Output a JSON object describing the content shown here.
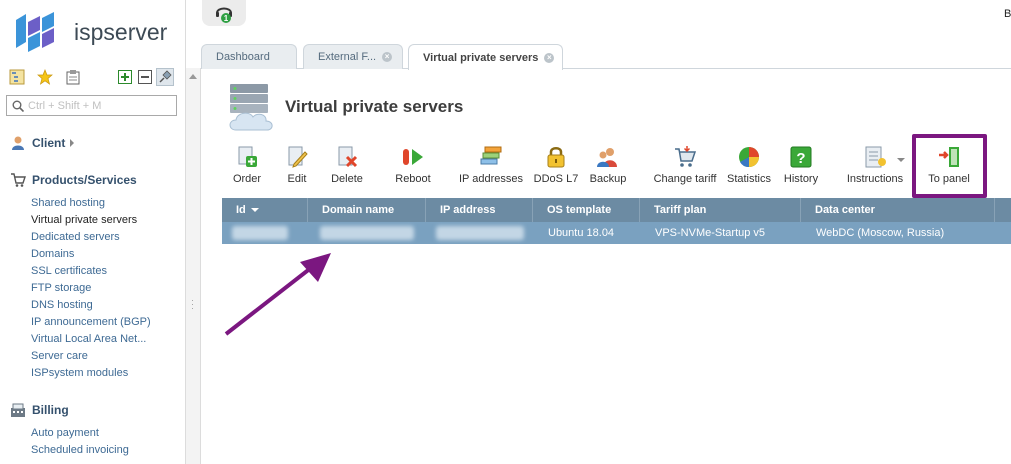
{
  "app": {
    "logo_text": "ispserver",
    "user_initial": "B",
    "notification_count": "1"
  },
  "sidebar": {
    "search_placeholder": "Ctrl + Shift + M",
    "groups": [
      {
        "label": "Client",
        "items": []
      },
      {
        "label": "Products/Services",
        "items": [
          "Shared hosting",
          "Virtual private servers",
          "Dedicated servers",
          "Domains",
          "SSL certificates",
          "FTP storage",
          "DNS hosting",
          "IP announcement (BGP)",
          "Virtual Local Area Net...",
          "Server care",
          "ISPsystem modules"
        ]
      },
      {
        "label": "Billing",
        "items": [
          "Auto payment",
          "Scheduled invoicing"
        ]
      }
    ],
    "active_item": "Virtual private servers"
  },
  "tabs": [
    {
      "label": "Dashboard"
    },
    {
      "label": "External F..."
    },
    {
      "label": "Virtual private servers"
    }
  ],
  "page": {
    "title": "Virtual private servers"
  },
  "toolbar": {
    "buttons": [
      {
        "label": "Order",
        "icon": "order-plus-icon"
      },
      {
        "label": "Edit",
        "icon": "edit-icon"
      },
      {
        "label": "Delete",
        "icon": "delete-icon"
      },
      {
        "label": "Reboot",
        "icon": "reboot-icon"
      },
      {
        "label": "IP addresses",
        "icon": "ip-addresses-icon"
      },
      {
        "label": "DDoS L7",
        "icon": "lock-icon"
      },
      {
        "label": "Backup",
        "icon": "backup-icon"
      },
      {
        "label": "Change tariff",
        "icon": "cart-icon"
      },
      {
        "label": "Statistics",
        "icon": "pie-chart-icon"
      },
      {
        "label": "History",
        "icon": "history-icon"
      },
      {
        "label": "Instructions",
        "icon": "instructions-icon"
      },
      {
        "label": "To panel",
        "icon": "to-panel-icon"
      }
    ]
  },
  "grid": {
    "columns": [
      "Id",
      "Domain name",
      "IP address",
      "OS template",
      "Tariff plan",
      "Data center"
    ],
    "rows": [
      {
        "os_template": "Ubuntu 18.04",
        "tariff_plan": "VPS-NVMe-Startup v5",
        "data_center": "WebDC (Moscow, Russia)"
      }
    ]
  },
  "colors": {
    "grid_header": "#6c8ba3",
    "selected_row": "#7aa1c0",
    "highlight": "#7b1780",
    "link": "#3e6a94"
  }
}
